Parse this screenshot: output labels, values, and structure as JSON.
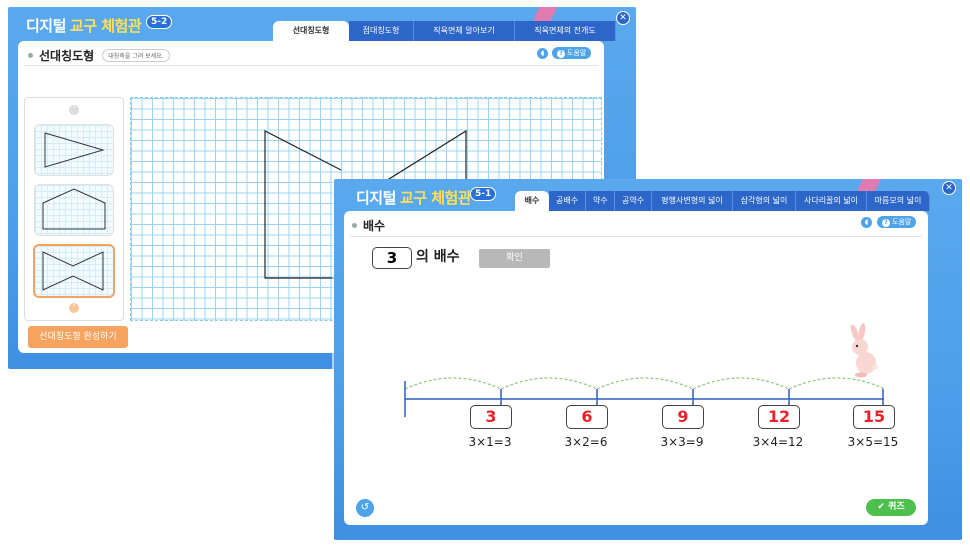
{
  "window1": {
    "brand_part1": "디지털",
    "brand_part2": "교구 체험관",
    "grade": "5-2",
    "tabs": [
      "선대칭도형",
      "점대칭도형",
      "직육면체 알아보기",
      "직육면체의 전개도"
    ],
    "active_tab": 0,
    "panel_title": "선대칭도형",
    "hint": "대칭축을 그려 보세요.",
    "help_label": "도움말",
    "help_mark": "?",
    "complete_button": "선대칭도형 완성하기",
    "close_glyph": "✕",
    "speaker_glyph": "◖",
    "arrow_up_glyph": "˄",
    "arrow_down_glyph": "˅"
  },
  "window2": {
    "brand_part1": "디지털",
    "brand_part2": "교구 체험관",
    "grade": "5-1",
    "tabs": [
      "배수",
      "공배수",
      "약수",
      "공약수",
      "평행사변형의 넓이",
      "삼각형의 넓이",
      "사다리꼴의 넓이",
      "마름모의 넓이"
    ],
    "active_tab": 0,
    "panel_title": "배수",
    "help_label": "도움말",
    "help_mark": "?",
    "number": "3",
    "number_suffix": "의 배수",
    "confirm_button": "확인",
    "multiples": [
      {
        "value": "3",
        "equation": "3×1=3"
      },
      {
        "value": "6",
        "equation": "3×2=6"
      },
      {
        "value": "9",
        "equation": "3×3=9"
      },
      {
        "value": "12",
        "equation": "3×4=12"
      },
      {
        "value": "15",
        "equation": "3×5=15"
      }
    ],
    "quiz_button": "퀴즈",
    "quiz_icon": "✔",
    "reset_icon": "↺",
    "close_glyph": "✕",
    "speaker_glyph": "◖"
  },
  "colors": {
    "window_blue": "#4d9eea",
    "tab_blue": "#2d66c9",
    "accent_orange": "#f6a35f",
    "multiple_red": "#e8222b",
    "quiz_green": "#4cbf4c",
    "numberline_blue": "#2f5cc4",
    "jump_green": "#8cc67a"
  }
}
